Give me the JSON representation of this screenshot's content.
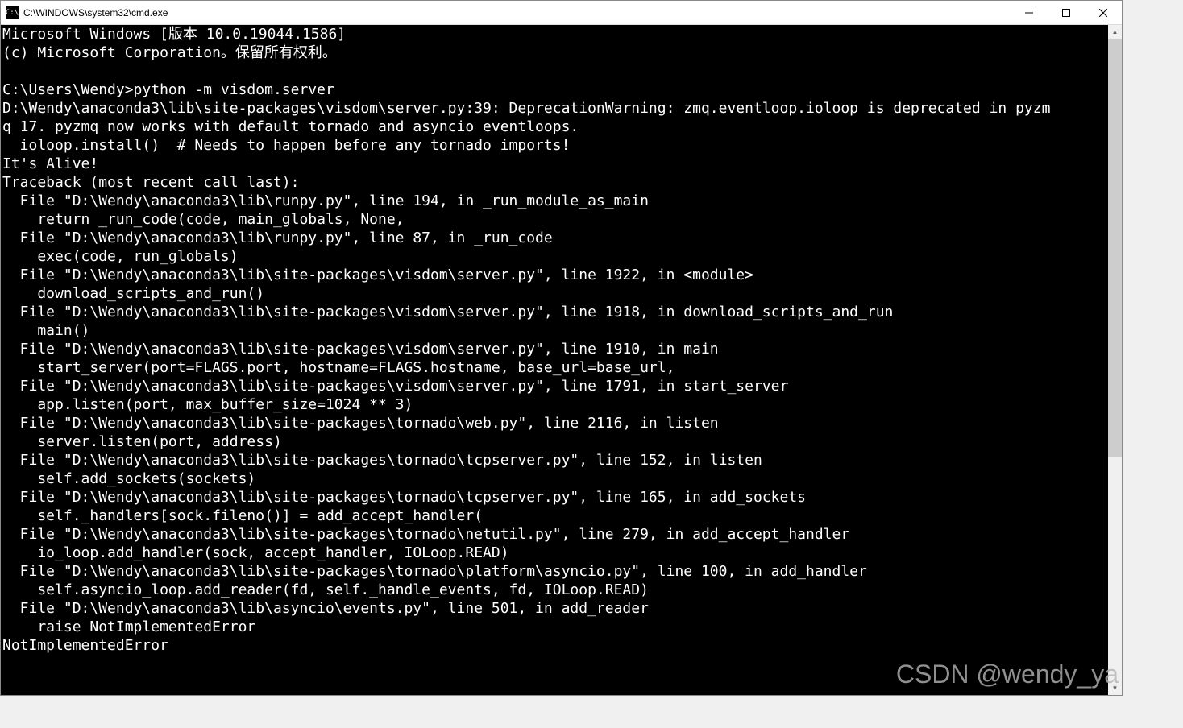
{
  "window": {
    "title": "C:\\WINDOWS\\system32\\cmd.exe",
    "icon_label": "C:\\"
  },
  "terminal": {
    "lines": [
      "Microsoft Windows [版本 10.0.19044.1586]",
      "(c) Microsoft Corporation。保留所有权利。",
      "",
      "C:\\Users\\Wendy>python -m visdom.server",
      "D:\\Wendy\\anaconda3\\lib\\site-packages\\visdom\\server.py:39: DeprecationWarning: zmq.eventloop.ioloop is deprecated in pyzm",
      "q 17. pyzmq now works with default tornado and asyncio eventloops.",
      "  ioloop.install()  # Needs to happen before any tornado imports!",
      "It's Alive!",
      "Traceback (most recent call last):",
      "  File \"D:\\Wendy\\anaconda3\\lib\\runpy.py\", line 194, in _run_module_as_main",
      "    return _run_code(code, main_globals, None,",
      "  File \"D:\\Wendy\\anaconda3\\lib\\runpy.py\", line 87, in _run_code",
      "    exec(code, run_globals)",
      "  File \"D:\\Wendy\\anaconda3\\lib\\site-packages\\visdom\\server.py\", line 1922, in <module>",
      "    download_scripts_and_run()",
      "  File \"D:\\Wendy\\anaconda3\\lib\\site-packages\\visdom\\server.py\", line 1918, in download_scripts_and_run",
      "    main()",
      "  File \"D:\\Wendy\\anaconda3\\lib\\site-packages\\visdom\\server.py\", line 1910, in main",
      "    start_server(port=FLAGS.port, hostname=FLAGS.hostname, base_url=base_url,",
      "  File \"D:\\Wendy\\anaconda3\\lib\\site-packages\\visdom\\server.py\", line 1791, in start_server",
      "    app.listen(port, max_buffer_size=1024 ** 3)",
      "  File \"D:\\Wendy\\anaconda3\\lib\\site-packages\\tornado\\web.py\", line 2116, in listen",
      "    server.listen(port, address)",
      "  File \"D:\\Wendy\\anaconda3\\lib\\site-packages\\tornado\\tcpserver.py\", line 152, in listen",
      "    self.add_sockets(sockets)",
      "  File \"D:\\Wendy\\anaconda3\\lib\\site-packages\\tornado\\tcpserver.py\", line 165, in add_sockets",
      "    self._handlers[sock.fileno()] = add_accept_handler(",
      "  File \"D:\\Wendy\\anaconda3\\lib\\site-packages\\tornado\\netutil.py\", line 279, in add_accept_handler",
      "    io_loop.add_handler(sock, accept_handler, IOLoop.READ)",
      "  File \"D:\\Wendy\\anaconda3\\lib\\site-packages\\tornado\\platform\\asyncio.py\", line 100, in add_handler",
      "    self.asyncio_loop.add_reader(fd, self._handle_events, fd, IOLoop.READ)",
      "  File \"D:\\Wendy\\anaconda3\\lib\\asyncio\\events.py\", line 501, in add_reader",
      "    raise NotImplementedError",
      "NotImplementedError"
    ]
  },
  "watermark": "CSDN @wendy_ya"
}
